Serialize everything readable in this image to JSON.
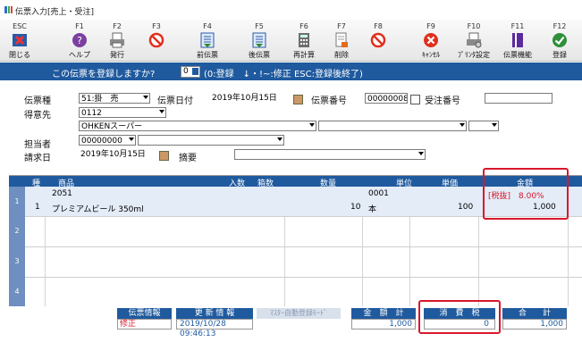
{
  "window": {
    "title": "伝票入力[売上・受注]"
  },
  "toolbar": [
    {
      "key": "ESC",
      "label": "閉じる",
      "icon": "close-app-icon"
    },
    {
      "key": "F1",
      "label": "ヘルプ",
      "icon": "help-icon"
    },
    {
      "key": "F2",
      "label": "発行",
      "icon": "printer-icon"
    },
    {
      "key": "F3",
      "label": "",
      "icon": "prohibited-icon"
    },
    {
      "key": "F4",
      "label": "前伝票",
      "icon": "previous-slip-icon"
    },
    {
      "key": "F5",
      "label": "後伝票",
      "icon": "next-slip-icon"
    },
    {
      "key": "F6",
      "label": "再計算",
      "icon": "calculator-icon"
    },
    {
      "key": "F7",
      "label": "削除",
      "icon": "delete-doc-icon"
    },
    {
      "key": "F8",
      "label": "",
      "icon": "prohibited-icon"
    },
    {
      "key": "F9",
      "label": "ｷｬﾝｾﾙ",
      "icon": "cancel-icon"
    },
    {
      "key": "F10",
      "label": "ﾌﾟﾘﾝﾀ設定",
      "icon": "printer-settings-icon"
    },
    {
      "key": "F11",
      "label": "伝票機能",
      "icon": "slip-function-icon"
    },
    {
      "key": "F12",
      "label": "登録",
      "icon": "register-check-icon"
    }
  ],
  "prompt": {
    "question": "この伝票を登録しますか?",
    "input_value": "0",
    "hint": "(0:登録　↓・!~:修正 ESC:登録後終了)"
  },
  "form": {
    "slip_type_label": "伝票種",
    "slip_type_value": "51:掛　売",
    "slip_date_label": "伝票日付",
    "slip_date_value": "2019年10月15日",
    "slip_number_label": "伝票番号",
    "slip_number_value": "00000008",
    "order_number_label": "受注番号",
    "order_number_value": "",
    "customer_label": "得意先",
    "customer_code": "0112",
    "customer_name": "OHKENスーパー",
    "staff_label": "担当者",
    "staff_value": "00000000",
    "billing_date_label": "請求日",
    "billing_date_value": "2019年10月15日",
    "summary_label": "摘要",
    "summary_value": ""
  },
  "grid": {
    "headers": {
      "type": "種",
      "product": "商品",
      "qty_per": "入数",
      "boxes": "箱数",
      "quantity": "数量",
      "unit": "単位",
      "unit_price": "単価",
      "amount": "金額"
    },
    "rows": [
      {
        "num": "1",
        "type": "1",
        "code": "2051",
        "name": "プレミアムビール 350ml",
        "quantity": "10",
        "unit_code": "0001",
        "unit": "本",
        "unit_price": "100",
        "tax_note": "[税抜]　8.00%",
        "amount": "1,000"
      },
      {
        "num": "2"
      },
      {
        "num": "3"
      },
      {
        "num": "4"
      }
    ]
  },
  "status": {
    "slip_info_label": "伝票情報",
    "slip_info_value": "修正",
    "update_info_label": "更 新 情 報",
    "update_info_value": "2019/10/28 09:46:13",
    "master_label": "ﾏｽﾀｰ自動登録ﾓｰﾄﾞ",
    "amount_total_label": "金　額　計",
    "amount_total_value": "1,000",
    "tax_label": "消　費　税",
    "tax_value": "0",
    "total_label": "合　　計",
    "total_value": "1,000"
  },
  "colors": {
    "accent": "#1f5a9e",
    "highlight": "#d8182a"
  }
}
